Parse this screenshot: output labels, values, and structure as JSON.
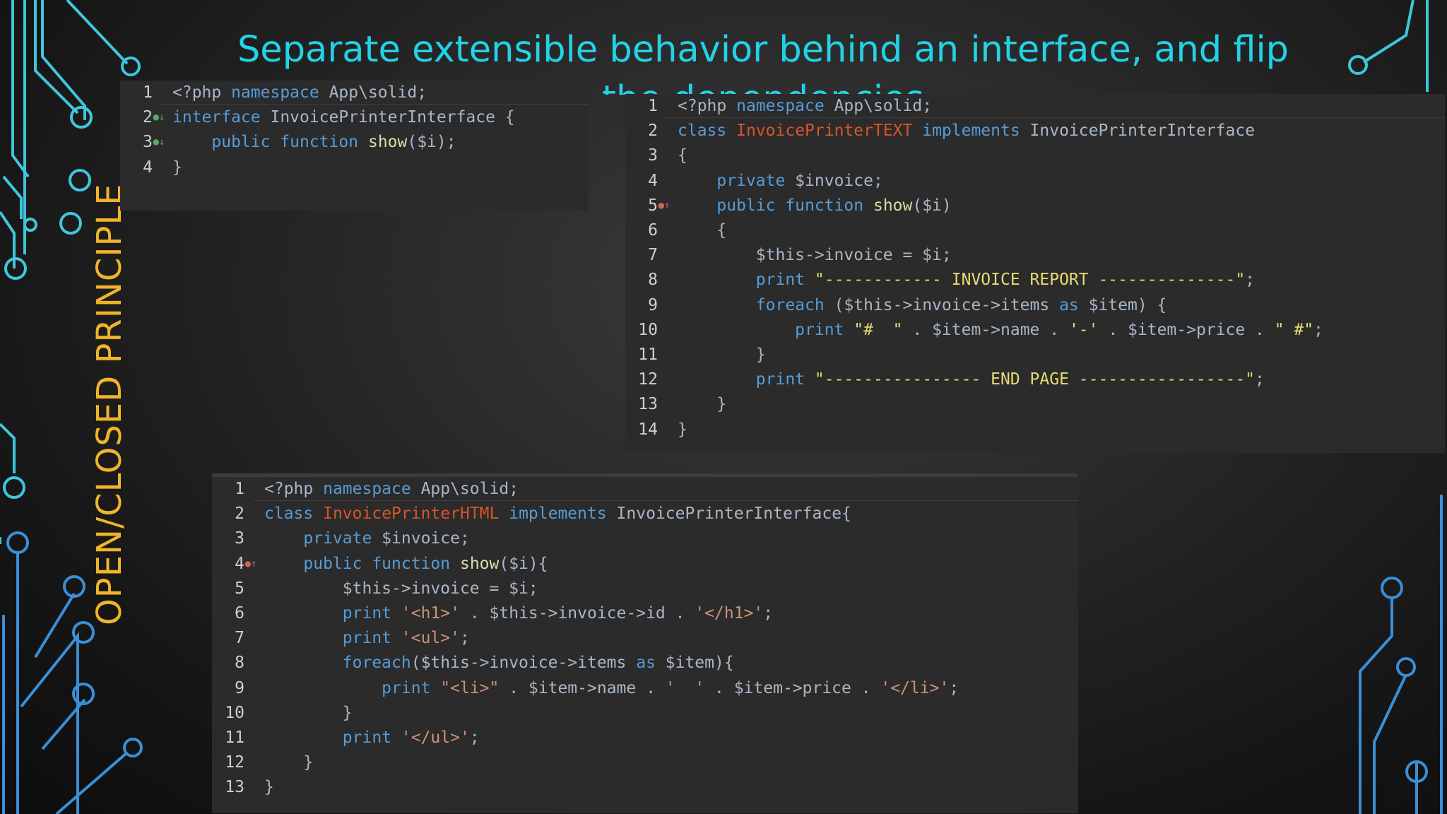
{
  "slide": {
    "title": "Separate extensible behavior behind an interface, and flip the dependencies",
    "side_title": "OPEN/CLOSED PRINCIPLE"
  },
  "colors": {
    "title": "#22d3e6",
    "side_title": "#f0b429",
    "code_bg": "#2b2b2b",
    "keyword": "#569cd6",
    "class_name": "#d9542b",
    "function_name": "#dcdcaa"
  },
  "panels": {
    "interface": {
      "lines": [
        {
          "n": "1",
          "segs": [
            [
              "op",
              "<?php "
            ],
            [
              "kw",
              "namespace"
            ],
            [
              "op",
              " App\\solid;"
            ]
          ]
        },
        {
          "n": "2",
          "mark": "implemented-icon",
          "segs": [
            [
              "kw",
              "interface"
            ],
            [
              "op",
              " InvoicePrinterInterface {"
            ]
          ]
        },
        {
          "n": "3",
          "mark": "implemented-icon",
          "segs": [
            [
              "op",
              "    "
            ],
            [
              "kw",
              "public function"
            ],
            [
              "op",
              " "
            ],
            [
              "fn",
              "show"
            ],
            [
              "op",
              "($i);"
            ]
          ]
        },
        {
          "n": "4",
          "segs": [
            [
              "op",
              "}"
            ]
          ]
        }
      ]
    },
    "text_printer": {
      "lines": [
        {
          "n": "1",
          "segs": [
            [
              "op",
              "<?php "
            ],
            [
              "kw",
              "namespace"
            ],
            [
              "op",
              " App\\solid;"
            ]
          ]
        },
        {
          "n": "2",
          "segs": [
            [
              "kw",
              "class"
            ],
            [
              "op",
              " "
            ],
            [
              "cls",
              "InvoicePrinterTEXT"
            ],
            [
              "op",
              " "
            ],
            [
              "kw",
              "implements"
            ],
            [
              "op",
              " InvoicePrinterInterface"
            ]
          ]
        },
        {
          "n": "3",
          "segs": [
            [
              "op",
              "{"
            ]
          ]
        },
        {
          "n": "4",
          "segs": [
            [
              "op",
              "    "
            ],
            [
              "kw",
              "private"
            ],
            [
              "op",
              " $invoice;"
            ]
          ]
        },
        {
          "n": "5",
          "mark": "override-icon",
          "segs": [
            [
              "op",
              "    "
            ],
            [
              "kw",
              "public function"
            ],
            [
              "op",
              " "
            ],
            [
              "fn",
              "show"
            ],
            [
              "op",
              "($i)"
            ]
          ]
        },
        {
          "n": "6",
          "segs": [
            [
              "op",
              "    {"
            ]
          ]
        },
        {
          "n": "7",
          "segs": [
            [
              "op",
              "        $this->invoice = $i;"
            ]
          ]
        },
        {
          "n": "8",
          "segs": [
            [
              "op",
              "        "
            ],
            [
              "kw",
              "print"
            ],
            [
              "op",
              " "
            ],
            [
              "str",
              "\"------------ INVOICE REPORT --------------\""
            ],
            [
              "op",
              ";"
            ]
          ]
        },
        {
          "n": "9",
          "segs": [
            [
              "op",
              "        "
            ],
            [
              "kw",
              "foreach"
            ],
            [
              "op",
              " ($this->invoice->items "
            ],
            [
              "kw",
              "as"
            ],
            [
              "op",
              " $item) {"
            ]
          ]
        },
        {
          "n": "10",
          "segs": [
            [
              "op",
              "            "
            ],
            [
              "kw",
              "print"
            ],
            [
              "op",
              " "
            ],
            [
              "str",
              "\"#  \""
            ],
            [
              "op",
              " . $item->name . "
            ],
            [
              "str",
              "'-'"
            ],
            [
              "op",
              " . $item->price . "
            ],
            [
              "str",
              "\" #\""
            ],
            [
              "op",
              ";"
            ]
          ]
        },
        {
          "n": "11",
          "segs": [
            [
              "op",
              "        }"
            ]
          ]
        },
        {
          "n": "12",
          "segs": [
            [
              "op",
              "        "
            ],
            [
              "kw",
              "print"
            ],
            [
              "op",
              " "
            ],
            [
              "str",
              "\"---------------- END PAGE -----------------\""
            ],
            [
              "op",
              ";"
            ]
          ]
        },
        {
          "n": "13",
          "segs": [
            [
              "op",
              "    }"
            ]
          ]
        },
        {
          "n": "14",
          "segs": [
            [
              "op",
              "}"
            ]
          ]
        }
      ]
    },
    "html_printer": {
      "lines": [
        {
          "n": "1",
          "segs": [
            [
              "op",
              "<?php "
            ],
            [
              "kw",
              "namespace"
            ],
            [
              "op",
              " App\\solid;"
            ]
          ]
        },
        {
          "n": "2",
          "segs": [
            [
              "kw",
              "class"
            ],
            [
              "op",
              " "
            ],
            [
              "cls",
              "InvoicePrinterHTML"
            ],
            [
              "op",
              " "
            ],
            [
              "kw",
              "implements"
            ],
            [
              "op",
              " InvoicePrinterInterface{"
            ]
          ]
        },
        {
          "n": "3",
          "segs": [
            [
              "op",
              "    "
            ],
            [
              "kw",
              "private"
            ],
            [
              "op",
              " $invoice;"
            ]
          ]
        },
        {
          "n": "4",
          "mark": "override-icon",
          "segs": [
            [
              "op",
              "    "
            ],
            [
              "kw",
              "public function"
            ],
            [
              "op",
              " "
            ],
            [
              "fn",
              "show"
            ],
            [
              "op",
              "($i){"
            ]
          ]
        },
        {
          "n": "5",
          "segs": [
            [
              "op",
              "        $this->invoice = $i;"
            ]
          ]
        },
        {
          "n": "6",
          "segs": [
            [
              "op",
              "        "
            ],
            [
              "kw",
              "print"
            ],
            [
              "op",
              " "
            ],
            [
              "str2",
              "'<h1>'"
            ],
            [
              "op",
              " . $this->invoice->id . "
            ],
            [
              "str2",
              "'</h1>'"
            ],
            [
              "op",
              ";"
            ]
          ]
        },
        {
          "n": "7",
          "segs": [
            [
              "op",
              "        "
            ],
            [
              "kw",
              "print"
            ],
            [
              "op",
              " "
            ],
            [
              "str2",
              "'<ul>'"
            ],
            [
              "op",
              ";"
            ]
          ]
        },
        {
          "n": "8",
          "segs": [
            [
              "op",
              "        "
            ],
            [
              "kw",
              "foreach"
            ],
            [
              "op",
              "($this->invoice->items "
            ],
            [
              "kw",
              "as"
            ],
            [
              "op",
              " $item){"
            ]
          ]
        },
        {
          "n": "9",
          "segs": [
            [
              "op",
              "            "
            ],
            [
              "kw",
              "print"
            ],
            [
              "op",
              " "
            ],
            [
              "str2",
              "\"<li>\""
            ],
            [
              "op",
              " . $item->name . "
            ],
            [
              "str2",
              "'  '"
            ],
            [
              "op",
              " . $item->price . "
            ],
            [
              "str2",
              "'</li>'"
            ],
            [
              "op",
              ";"
            ]
          ]
        },
        {
          "n": "10",
          "segs": [
            [
              "op",
              "        }"
            ]
          ]
        },
        {
          "n": "11",
          "segs": [
            [
              "op",
              "        "
            ],
            [
              "kw",
              "print"
            ],
            [
              "op",
              " "
            ],
            [
              "str2",
              "'</ul>'"
            ],
            [
              "op",
              ";"
            ]
          ]
        },
        {
          "n": "12",
          "segs": [
            [
              "op",
              "    }"
            ]
          ]
        },
        {
          "n": "13",
          "segs": [
            [
              "op",
              "}"
            ]
          ]
        }
      ]
    }
  }
}
